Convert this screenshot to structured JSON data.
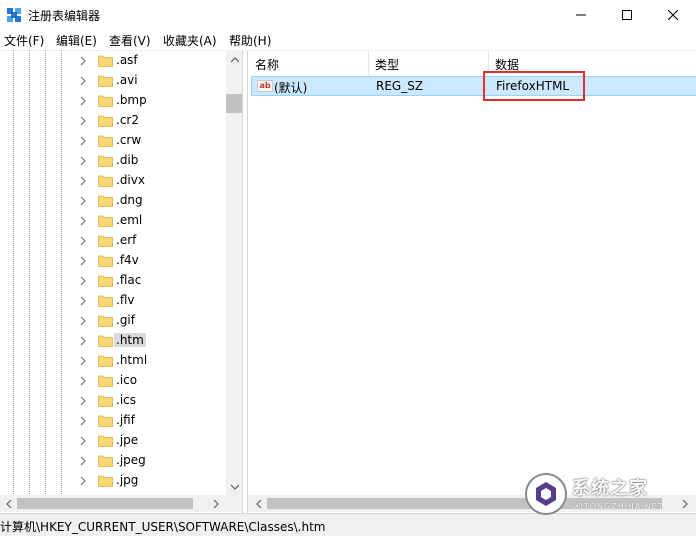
{
  "window": {
    "title": "注册表编辑器"
  },
  "menu": [
    {
      "label": "文件(F)"
    },
    {
      "label": "编辑(E)"
    },
    {
      "label": "查看(V)"
    },
    {
      "label": "收藏夹(A)"
    },
    {
      "label": "帮助(H)"
    }
  ],
  "tree": {
    "items": [
      {
        "label": ".asf"
      },
      {
        "label": ".avi"
      },
      {
        "label": ".bmp"
      },
      {
        "label": ".cr2"
      },
      {
        "label": ".crw"
      },
      {
        "label": ".dib"
      },
      {
        "label": ".divx"
      },
      {
        "label": ".dng"
      },
      {
        "label": ".eml"
      },
      {
        "label": ".erf"
      },
      {
        "label": ".f4v"
      },
      {
        "label": ".flac"
      },
      {
        "label": ".flv"
      },
      {
        "label": ".gif"
      },
      {
        "label": ".htm"
      },
      {
        "label": ".html"
      },
      {
        "label": ".ico"
      },
      {
        "label": ".ics"
      },
      {
        "label": ".jfif"
      },
      {
        "label": ".jpe"
      },
      {
        "label": ".jpeg"
      },
      {
        "label": ".jpg"
      }
    ],
    "selected_label": ".htm"
  },
  "list": {
    "columns": [
      "名称",
      "类型",
      "数据"
    ],
    "rows": [
      {
        "name": "(默认)",
        "type": "REG_SZ",
        "data": "FirefoxHTML",
        "icon_text": "ab"
      }
    ]
  },
  "status": {
    "path": "计算机\\HKEY_CURRENT_USER\\SOFTWARE\\Classes\\.htm"
  },
  "watermark": {
    "text": "系统之家",
    "sub": "XITONGZHIJIA.NET"
  },
  "colors": {
    "selection": "#cce8ff",
    "selection_border": "#99d1ff",
    "highlight_box": "#e0302e",
    "folder": "#f8d775",
    "scrollbar_thumb": "#c2c2c2"
  },
  "icons": {
    "app": "regedit-icon",
    "minimize": "minimize-icon",
    "maximize": "maximize-icon",
    "close": "close-icon",
    "chevron": "chevron-right-icon",
    "folder": "folder-icon",
    "string_value": "ab-string-icon"
  }
}
